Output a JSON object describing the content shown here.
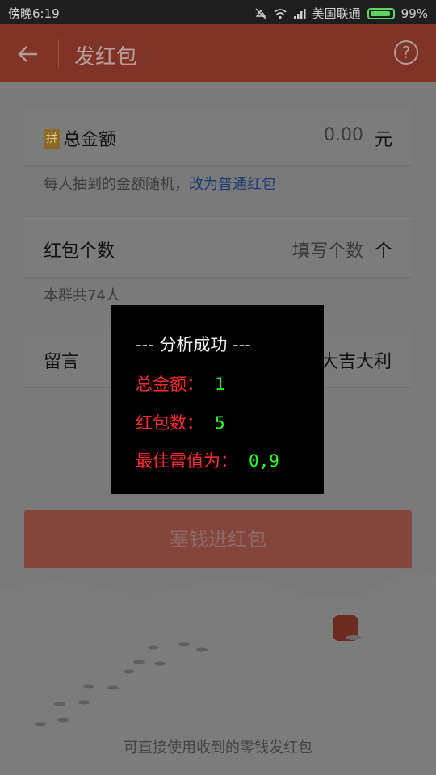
{
  "status_bar": {
    "time": "傍晚6:19",
    "carrier": "美国联通",
    "battery": "99%"
  },
  "header": {
    "title": "发红包",
    "help_label": "?"
  },
  "form": {
    "total_amount": {
      "badge": "拼",
      "label": "总金额",
      "value": "0.00",
      "unit": "元"
    },
    "random_hint": "每人抽到的金额随机，",
    "switch_link": "改为普通红包",
    "count": {
      "label": "红包个数",
      "placeholder": "填写个数",
      "unit": "个"
    },
    "group_hint": "本群共74人",
    "message": {
      "label": "留言",
      "value": "大吉大利"
    },
    "send_button": "塞钱进红包",
    "footer_hint": "可直接使用收到的零钱发红包"
  },
  "toast": {
    "heading": "--- 分析成功 ---",
    "rows": [
      {
        "key": "总金额：",
        "value": "1"
      },
      {
        "key": "红包数：",
        "value": "5"
      },
      {
        "key": "最佳雷值为：",
        "value": "0,9"
      }
    ]
  },
  "colors": {
    "header_bg": "#7f3427",
    "toast_key": "#ff2a2a",
    "toast_value": "#2aff2a",
    "link": "#1f3d73",
    "battery": "#5fd35f"
  },
  "icons": [
    "back-arrow-icon",
    "help-circle-icon",
    "mute-icon",
    "wifi-icon",
    "signal-icon",
    "battery-icon"
  ]
}
